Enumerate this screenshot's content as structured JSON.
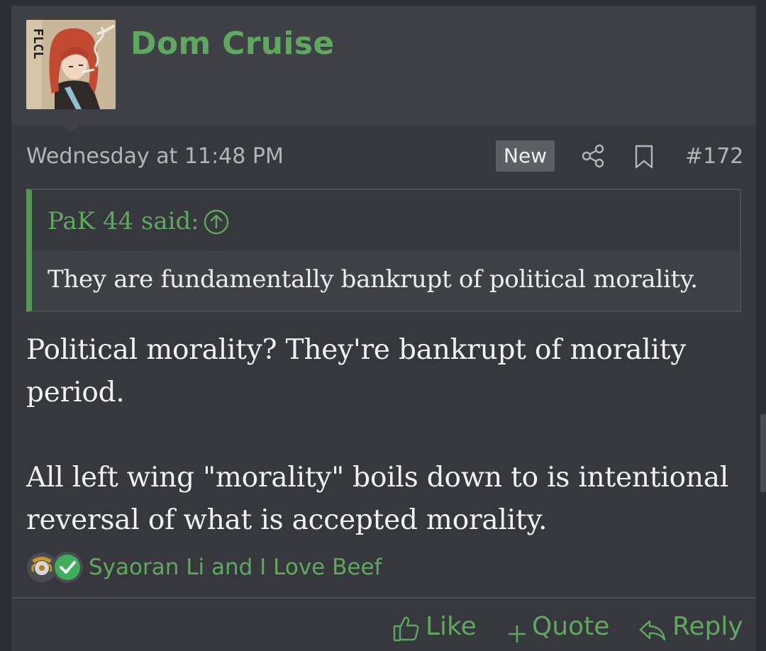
{
  "post": {
    "username": "Dom Cruise",
    "timestamp": "Wednesday at 11:48 PM",
    "new_badge": "New",
    "post_number": "#172",
    "avatar_text": "FLCL"
  },
  "quote": {
    "author_said": "PaK 44 said:",
    "text": "They are fundamentally bankrupt of political morality."
  },
  "message": {
    "paragraph1": "Political morality? They're bankrupt of morality period.",
    "paragraph2": "All left wing \"morality\" boils down to is intentional reversal of what is accepted morality."
  },
  "reactions": {
    "users_text": "Syaoran Li and I Love Beef"
  },
  "actions": {
    "like": "Like",
    "quote": "Quote",
    "reply": "Reply"
  },
  "colors": {
    "accent_green": "#5fa95f",
    "quote_bar": "#4e9a4e",
    "background": "#36383d",
    "header_bg": "#3f4147"
  },
  "icons": [
    "share-icon",
    "bookmark-icon",
    "arrow-up-circle-icon",
    "thumbs-up-icon",
    "plus-icon",
    "reply-arrow-icon",
    "checkmark-icon"
  ]
}
